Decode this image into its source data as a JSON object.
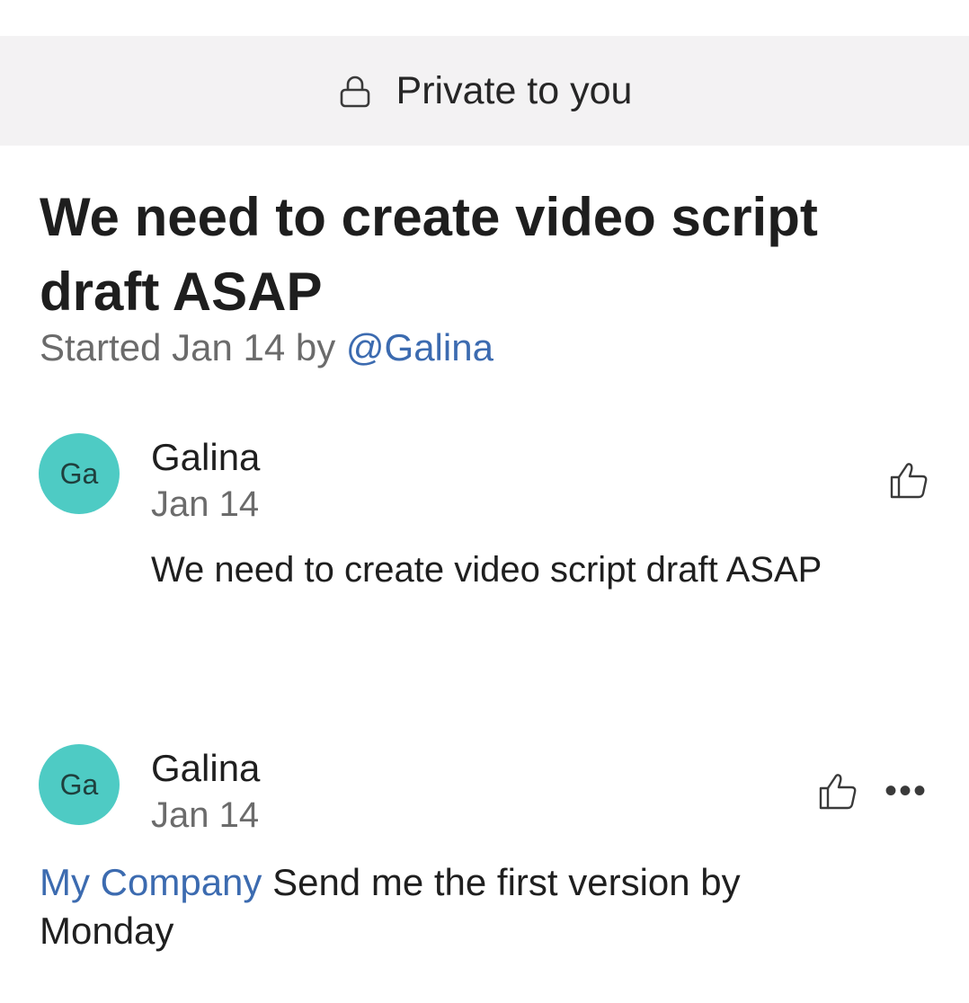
{
  "banner": {
    "icon": "lock-icon",
    "text": "Private to you"
  },
  "thread": {
    "title": "We need to create video script draft ASAP",
    "started_prefix": "Started Jan 14 by",
    "started_by": "@Galina"
  },
  "posts": [
    {
      "avatar_initials": "Ga",
      "author": "Galina",
      "date": "Jan 14",
      "body": "We need to create video script draft ASAP",
      "like_icon": "thumbs-up-icon"
    },
    {
      "avatar_initials": "Ga",
      "author": "Galina",
      "date": "Jan 14",
      "mention": "My Company",
      "body": "Send me the first version by Monday",
      "like_icon": "thumbs-up-icon",
      "more_icon": "more-options-icon",
      "more_label": "•••"
    }
  ],
  "colors": {
    "banner_bg": "#f3f2f3",
    "avatar_bg": "#4ecbc4",
    "mention": "#3c6bb0",
    "muted_text": "#6b6b6b"
  }
}
